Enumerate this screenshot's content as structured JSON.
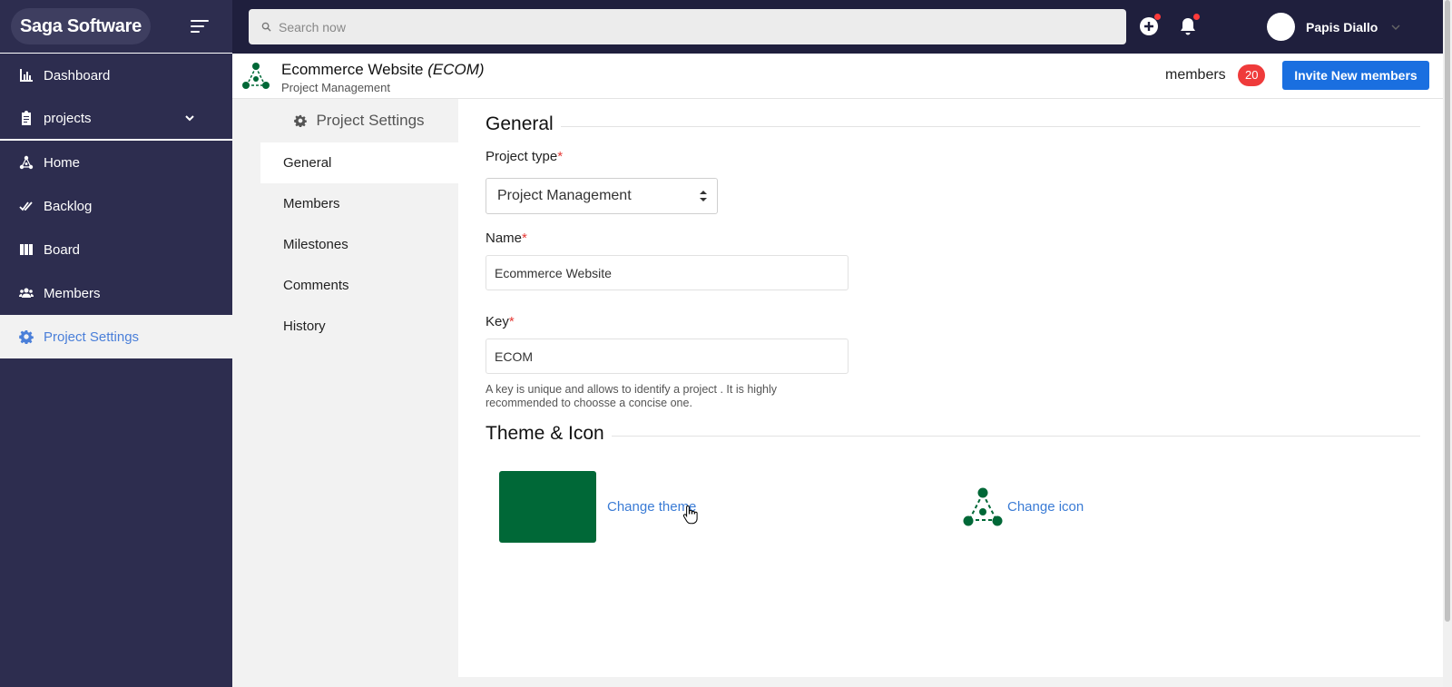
{
  "brand": {
    "name": "Saga Software"
  },
  "search": {
    "placeholder": "Search now"
  },
  "user": {
    "name": "Papis Diallo"
  },
  "sidebar": {
    "items": [
      {
        "label": "Dashboard",
        "icon": "chart-icon"
      },
      {
        "label": "projects",
        "icon": "clipboard-icon"
      },
      {
        "label": "Home",
        "icon": "project-network-icon"
      },
      {
        "label": "Backlog",
        "icon": "double-check-icon"
      },
      {
        "label": "Board",
        "icon": "columns-icon"
      },
      {
        "label": "Members",
        "icon": "users-icon"
      },
      {
        "label": "Project Settings",
        "icon": "gear-icon"
      }
    ]
  },
  "project": {
    "name": "Ecommerce Website",
    "key_display": "(ECOM)",
    "type": "Project Management",
    "members_label": "members",
    "members_count": "20",
    "invite_label": "Invite New members"
  },
  "settings_menu": {
    "title": "Project Settings",
    "items": [
      "General",
      "Members",
      "Milestones",
      "Comments",
      "History"
    ]
  },
  "general": {
    "title": "General",
    "project_type_label": "Project type",
    "project_type_value": "Project Management",
    "name_label": "Name",
    "name_value": "Ecommerce Website",
    "key_label": "Key",
    "key_value": "ECOM",
    "key_help": "A key is unique and allows to identify a project . It is highly recommended to choosse a concise one.",
    "required_mark": "*"
  },
  "theme": {
    "title": "Theme & Icon",
    "change_theme_label": "Change theme",
    "change_icon_label": "Change icon",
    "theme_color": "#006837"
  },
  "colors": {
    "sidebar_bg": "#2d2d4f",
    "topbar_bg": "#1f1f3d",
    "accent_blue": "#1a6fe0",
    "link_blue": "#3a7bd5",
    "badge_red": "#ef3b3b",
    "project_green": "#006837"
  }
}
